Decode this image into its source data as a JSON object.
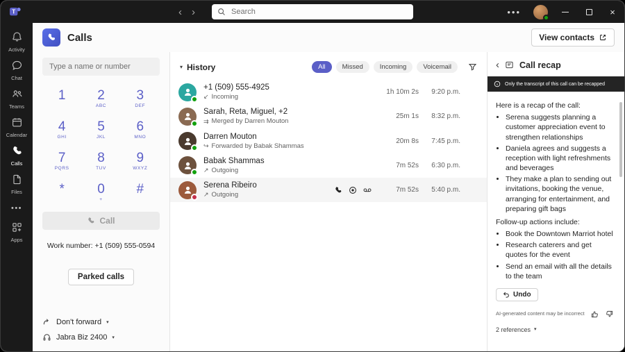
{
  "titlebar": {
    "search_placeholder": "Search"
  },
  "rail": {
    "items": [
      {
        "label": "Activity"
      },
      {
        "label": "Chat"
      },
      {
        "label": "Teams"
      },
      {
        "label": "Calendar"
      },
      {
        "label": "Calls"
      },
      {
        "label": "Files"
      },
      {
        "label": "Apps"
      }
    ]
  },
  "header": {
    "title": "Calls",
    "view_contacts_label": "View contacts"
  },
  "dialpad": {
    "input_placeholder": "Type a name or number",
    "keys": [
      {
        "digit": "1",
        "letters": ""
      },
      {
        "digit": "2",
        "letters": "ABC"
      },
      {
        "digit": "3",
        "letters": "DEF"
      },
      {
        "digit": "4",
        "letters": "GHI"
      },
      {
        "digit": "5",
        "letters": "JKL"
      },
      {
        "digit": "6",
        "letters": "MNO"
      },
      {
        "digit": "7",
        "letters": "PQRS"
      },
      {
        "digit": "8",
        "letters": "TUV"
      },
      {
        "digit": "9",
        "letters": "WXYZ"
      },
      {
        "digit": "*",
        "letters": ""
      },
      {
        "digit": "0",
        "letters": "+"
      },
      {
        "digit": "#",
        "letters": ""
      }
    ],
    "call_button_label": "Call",
    "work_number": "Work number: +1 (509) 555-0594",
    "parked_calls_label": "Parked calls",
    "forward_setting": "Don't forward",
    "audio_device": "Jabra Biz 2400"
  },
  "history": {
    "title": "History",
    "filters": [
      {
        "label": "All"
      },
      {
        "label": "Missed"
      },
      {
        "label": "Incoming"
      },
      {
        "label": "Voicemail"
      }
    ],
    "rows": [
      {
        "name": "+1 (509) 555-4925",
        "detail": "Incoming",
        "duration": "1h 10m 2s",
        "time": "9:20 p.m."
      },
      {
        "name": "Sarah, Reta, Miguel, +2",
        "detail": "Merged by Darren Mouton",
        "duration": "25m 1s",
        "time": "8:32 p.m."
      },
      {
        "name": "Darren Mouton",
        "detail": "Forwarded by Babak Shammas",
        "duration": "20m 8s",
        "time": "7:45 p.m."
      },
      {
        "name": "Babak Shammas",
        "detail": "Outgoing",
        "duration": "7m 52s",
        "time": "6:30 p.m."
      },
      {
        "name": "Serena Ribeiro",
        "detail": "Outgoing",
        "duration": "7m 52s",
        "time": "5:40 p.m."
      }
    ]
  },
  "recap": {
    "title": "Call recap",
    "banner": "Only the transcript of this call can be recapped",
    "intro": "Here is a recap of the call:",
    "recap_points": [
      "Serena suggests planning a customer appreciation event to strengthen relationships",
      "Daniela agrees and suggests a reception with light refreshments and beverages",
      "They make a plan to sending out invitations, booking the venue, arranging for entertainment, and preparing gift bags"
    ],
    "followup_heading": "Follow-up actions include:",
    "followup_points": [
      "Book the Downtown Marriot hotel",
      "Research caterers and get quotes for the event",
      "Send an email with all the details to the team"
    ],
    "undo_label": "Undo",
    "disclaimer": "AI-generated content may be incorrect",
    "references_label": "2 references"
  },
  "colors": {
    "accent": "#5b5fc7",
    "calls_icon": "#4f6bed",
    "presence_available": "#13a10e",
    "presence_busy": "#c4314b"
  }
}
